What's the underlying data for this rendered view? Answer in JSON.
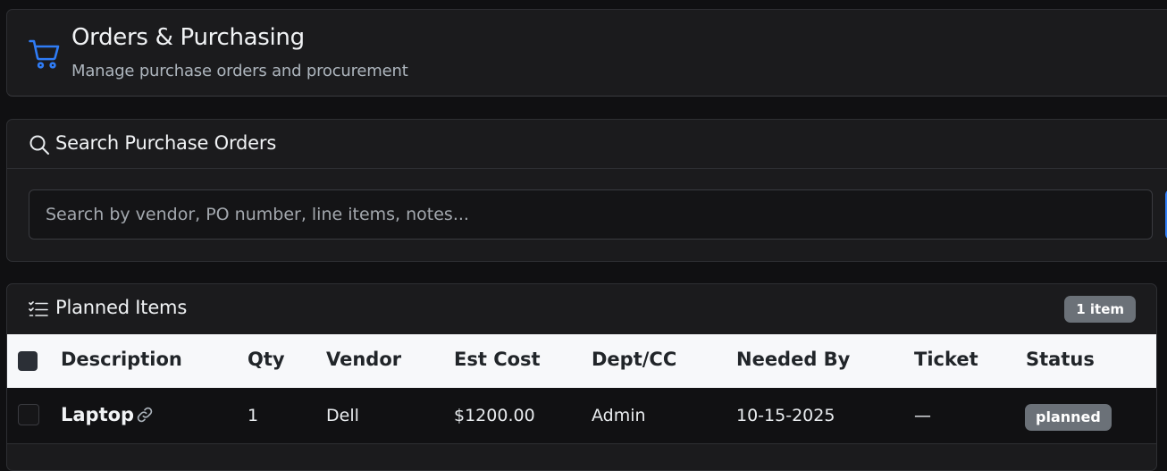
{
  "header": {
    "title": "Orders & Purchasing",
    "subtitle": "Manage purchase orders and procurement",
    "icon": "cart-icon",
    "accent_color": "#2f7cf6"
  },
  "search": {
    "title": "Search Purchase Orders",
    "icon": "search-icon",
    "placeholder": "Search by vendor, PO number, line items, notes...",
    "value": ""
  },
  "planned": {
    "title": "Planned Items",
    "icon": "checklist-icon",
    "count_badge": "1 item",
    "columns": [
      "Description",
      "Qty",
      "Vendor",
      "Est Cost",
      "Dept/CC",
      "Needed By",
      "Ticket",
      "Status"
    ],
    "rows": [
      {
        "description": "Laptop",
        "qty": "1",
        "vendor": "Dell",
        "est_cost": "$1200.00",
        "dept_cc": "Admin",
        "needed_by": "10-15-2025",
        "ticket": "—",
        "status": "planned"
      }
    ]
  }
}
